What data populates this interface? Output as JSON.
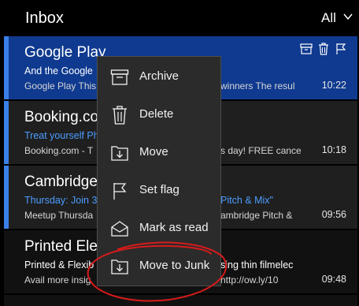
{
  "header": {
    "title": "Inbox",
    "filter_label": "All"
  },
  "emails": [
    {
      "sender": "Google Play",
      "subject": "And the Google",
      "preview": "Google Play This",
      "tail": "winners The resul",
      "time": "10:22"
    },
    {
      "sender": "Booking.com",
      "subject": "Treat yourself Ph",
      "preview": "Booking.com - T",
      "tail": "s day! FREE cance",
      "time": "10:18"
    },
    {
      "sender": "Cambridge",
      "subject": "Thursday: Join 3",
      "subject_tail": "Pitch & Mix\"",
      "preview": "Meetup Thursda",
      "tail": "ambridge Pitch &",
      "time": "09:56"
    },
    {
      "sender": "Printed Elect",
      "subject": "Printed & Flexib",
      "subject_tail": "sing thin filmelec",
      "preview": "Avail more insig",
      "tail": "http://ow.ly/10",
      "time": "09:48"
    }
  ],
  "context_menu": {
    "items": [
      {
        "label": "Archive",
        "icon": "archive-icon"
      },
      {
        "label": "Delete",
        "icon": "trash-icon"
      },
      {
        "label": "Move",
        "icon": "move-icon"
      },
      {
        "label": "Set flag",
        "icon": "flag-icon"
      },
      {
        "label": "Mark as read",
        "icon": "envelope-open-icon"
      },
      {
        "label": "Move to Junk",
        "icon": "junk-icon"
      }
    ]
  },
  "colors": {
    "selected_row": "#0f3a8f",
    "accent": "#3b80e8",
    "link_blue": "#4c9dff",
    "annotation_red": "#d61b1b"
  }
}
